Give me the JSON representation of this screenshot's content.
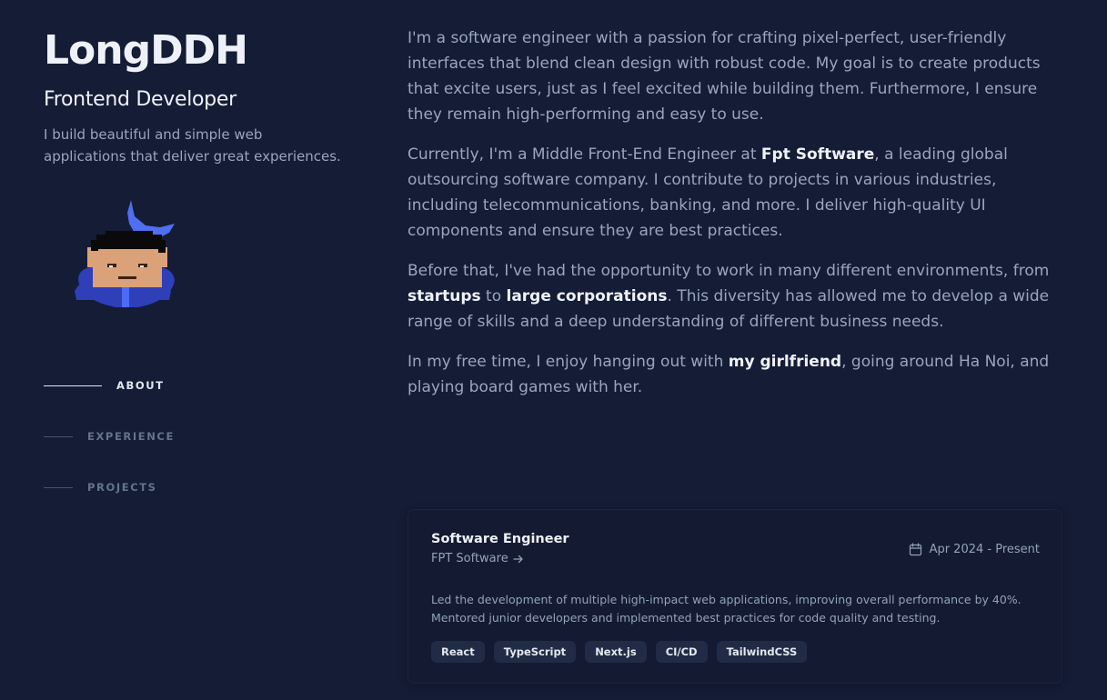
{
  "profile": {
    "name": "LongDDH",
    "role": "Frontend Developer",
    "tagline": "I build beautiful and simple web applications that deliver great experiences."
  },
  "nav": {
    "items": [
      {
        "label": "ABOUT",
        "active": true
      },
      {
        "label": "EXPERIENCE",
        "active": false
      },
      {
        "label": "PROJECTS",
        "active": false
      }
    ]
  },
  "about": {
    "p1": "I'm a software engineer with a passion for crafting pixel-perfect, user-friendly interfaces that blend clean design with robust code. My goal is to create products that excite users, just as I feel excited while building them. Furthermore, I ensure they remain high-performing and easy to use.",
    "p2_a": "Currently, I'm a Middle Front-End Engineer at ",
    "p2_b": "Fpt Software",
    "p2_c": ", a leading global outsourcing software company. I contribute to projects in various industries, including telecommunications, banking, and more. I deliver high-quality UI components and ensure they are best practices.",
    "p3_a": "Before that, I've had the opportunity to work in many different environments, from ",
    "p3_b": "startups",
    "p3_c": " to ",
    "p3_d": "large corporations",
    "p3_e": ". This diversity has allowed me to develop a wide range of skills and a deep understanding of different business needs.",
    "p4_a": "In my free time, I enjoy hanging out with ",
    "p4_b": "my girlfriend",
    "p4_c": ", going around Ha Noi, and playing board games with her."
  },
  "experience": {
    "title": "Software Engineer",
    "company": "FPT Software",
    "company_icon": "arrow-right-icon",
    "date_icon": "calendar-icon",
    "date": "Apr 2024 - Present",
    "description": "Led the development of multiple high-impact web applications, improving overall performance by 40%. Mentored junior developers and implemented best practices for code quality and testing.",
    "tags": [
      "React",
      "TypeScript",
      "Next.js",
      "CI/CD",
      "TailwindCSS"
    ]
  },
  "colors": {
    "background": "#141c36",
    "accent_moon": "#4f6ef0",
    "shirt": "#2f3fb8",
    "tie": "#4a6cf7",
    "skin": "#dba27a",
    "hair": "#0a0a0a"
  },
  "icons": {
    "moon": "moon-icon",
    "avatar": "pixel-avatar"
  }
}
